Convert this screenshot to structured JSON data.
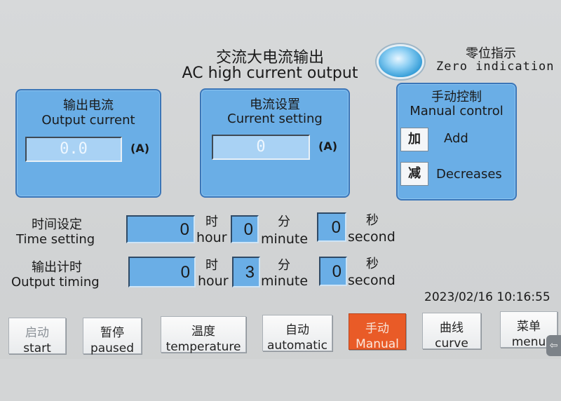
{
  "header": {
    "title_cn": "交流大电流输出",
    "title_en": "AC high current output"
  },
  "zero_indicator": {
    "label_cn": "零位指示",
    "label_en": "Zero indication",
    "lamp_color": "#2f9ad6"
  },
  "output_panel": {
    "title_cn": "输出电流",
    "title_en": "Output current",
    "value": "0.0",
    "unit": "(A)"
  },
  "setting_panel": {
    "title_cn": "电流设置",
    "title_en": "Current setting",
    "value": "0",
    "unit": "(A)"
  },
  "manual_panel": {
    "title_cn": "手动控制",
    "title_en": "Manual control",
    "add_btn": "加",
    "add_label": "Add",
    "dec_btn": "减",
    "dec_label": "Decreases"
  },
  "time_setting": {
    "label_cn": "时间设定",
    "label_en": "Time setting",
    "hour": "0",
    "minute": "0",
    "second": "0"
  },
  "output_timing": {
    "label_cn": "输出计时",
    "label_en": "Output timing",
    "hour": "0",
    "minute": "3",
    "second": "0"
  },
  "units": {
    "hour_cn": "时",
    "hour_en": "hour",
    "minute_cn": "分",
    "minute_en": "minute",
    "second_cn": "秒",
    "second_en": "second"
  },
  "clock": "2023/02/16 10:16:55",
  "bottom_buttons": [
    {
      "cn": "启动",
      "en": "start"
    },
    {
      "cn": "暂停",
      "en": "paused"
    },
    {
      "cn": "温度",
      "en": "temperature"
    },
    {
      "cn": "自动",
      "en": "automatic"
    },
    {
      "cn": "手动",
      "en": "Manual"
    },
    {
      "cn": "曲线",
      "en": "curve"
    },
    {
      "cn": "菜单",
      "en": "menu"
    }
  ],
  "colors": {
    "panel": "#6aaee6",
    "active_button": "#e95b27"
  }
}
